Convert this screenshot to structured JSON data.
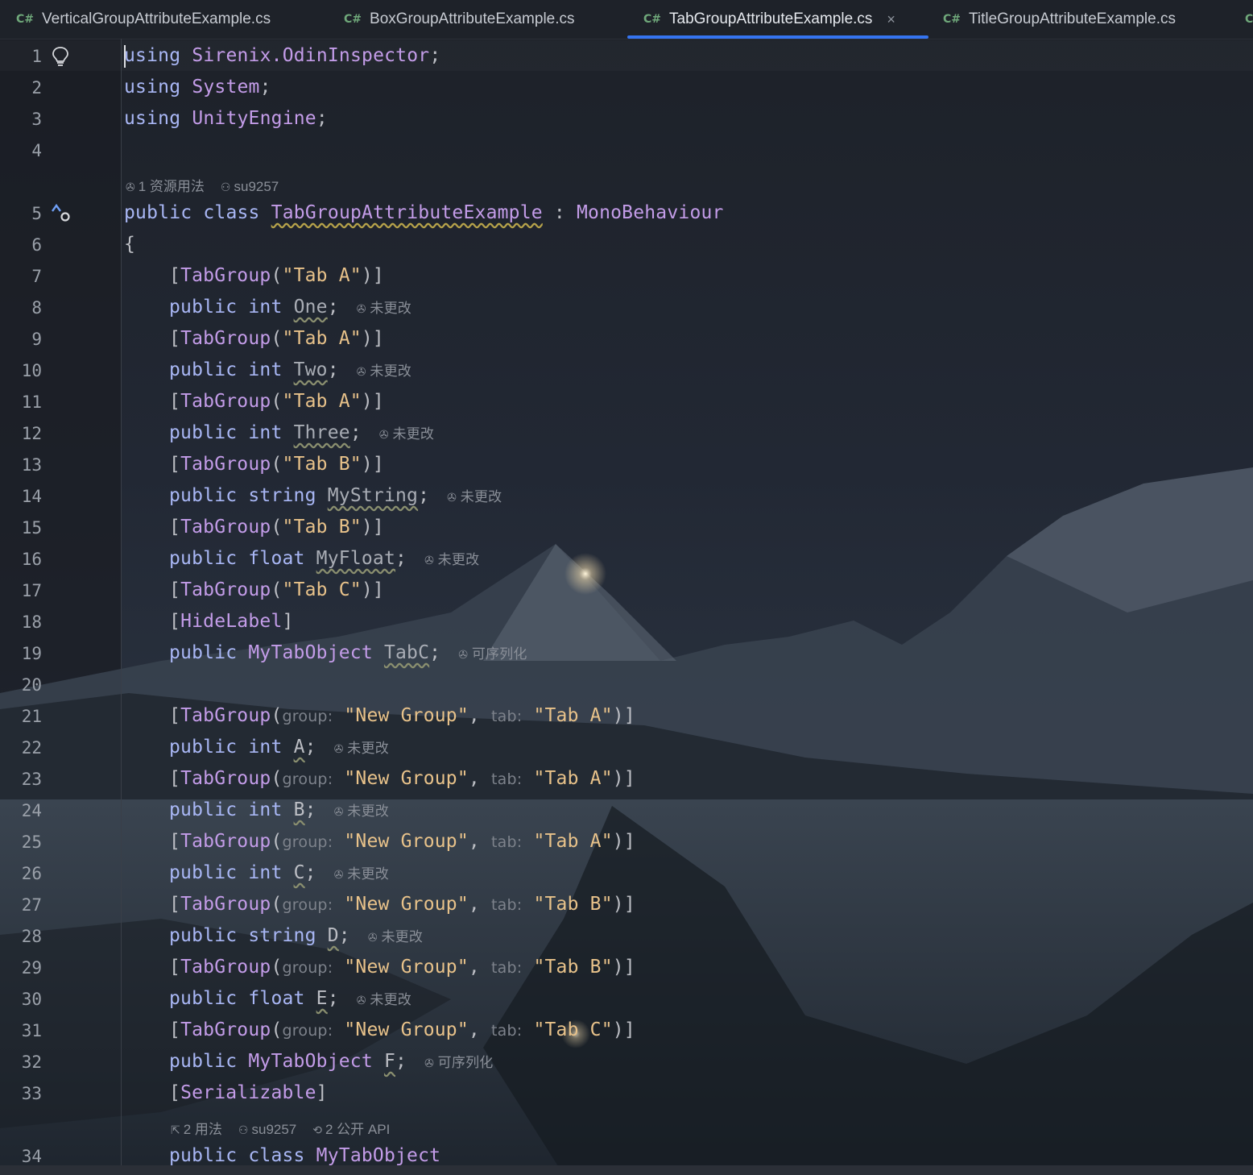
{
  "tabs": [
    {
      "lang": "C#",
      "name": "VerticalGroupAttributeExample.cs"
    },
    {
      "lang": "C#",
      "name": "BoxGroupAttributeExample.cs"
    },
    {
      "lang": "C#",
      "name": "TabGroupAttributeExample.cs",
      "close": "×"
    },
    {
      "lang": "C#",
      "name": "TitleGroupAttributeExample.cs"
    },
    {
      "lang": "C"
    }
  ],
  "line_numbers": [
    "1",
    "2",
    "3",
    "4",
    "5",
    "6",
    "7",
    "8",
    "9",
    "10",
    "11",
    "12",
    "13",
    "14",
    "15",
    "16",
    "17",
    "18",
    "19",
    "20",
    "21",
    "22",
    "23",
    "24",
    "25",
    "26",
    "27",
    "28",
    "29",
    "30",
    "31",
    "32",
    "33",
    "34"
  ],
  "code": {
    "l1": {
      "kw": "using",
      "ns": "Sirenix.OdinInspector",
      "end": ";"
    },
    "l2": {
      "kw": "using",
      "ns": "System",
      "end": ";"
    },
    "l3": {
      "kw": "using",
      "ns": "UnityEngine",
      "end": ";"
    },
    "l5": {
      "kw1": "public",
      "kw2": "class",
      "name": "TabGroupAttributeExample",
      "sep": " : ",
      "base": "MonoBehaviour"
    },
    "l6": "{",
    "l7": {
      "attr": "TabGroup",
      "arg": "\"Tab A\""
    },
    "l8": {
      "type": "int",
      "field": "One",
      "hint": "未更改"
    },
    "l9": {
      "attr": "TabGroup",
      "arg": "\"Tab A\""
    },
    "l10": {
      "type": "int",
      "field": "Two",
      "hint": "未更改"
    },
    "l11": {
      "attr": "TabGroup",
      "arg": "\"Tab A\""
    },
    "l12": {
      "type": "int",
      "field": "Three",
      "hint": "未更改"
    },
    "l13": {
      "attr": "TabGroup",
      "arg": "\"Tab B\""
    },
    "l14": {
      "type": "string",
      "field": "MyString",
      "hint": "未更改"
    },
    "l15": {
      "attr": "TabGroup",
      "arg": "\"Tab B\""
    },
    "l16": {
      "type": "float",
      "field": "MyFloat",
      "hint": "未更改"
    },
    "l17": {
      "attr": "TabGroup",
      "arg": "\"Tab C\""
    },
    "l18": {
      "attr": "HideLabel"
    },
    "l19": {
      "type": "MyTabObject",
      "field": "TabC",
      "hint": "可序列化"
    },
    "l21": {
      "attr": "TabGroup",
      "group_label": "group:",
      "group": "\"New Group\"",
      "tab_label": "tab:",
      "tab": "\"Tab A\""
    },
    "l22": {
      "type": "int",
      "field": "A",
      "hint": "未更改"
    },
    "l23": {
      "attr": "TabGroup",
      "group_label": "group:",
      "group": "\"New Group\"",
      "tab_label": "tab:",
      "tab": "\"Tab A\""
    },
    "l24": {
      "type": "int",
      "field": "B",
      "hint": "未更改"
    },
    "l25": {
      "attr": "TabGroup",
      "group_label": "group:",
      "group": "\"New Group\"",
      "tab_label": "tab:",
      "tab": "\"Tab A\""
    },
    "l26": {
      "type": "int",
      "field": "C",
      "hint": "未更改"
    },
    "l27": {
      "attr": "TabGroup",
      "group_label": "group:",
      "group": "\"New Group\"",
      "tab_label": "tab:",
      "tab": "\"Tab B\""
    },
    "l28": {
      "type": "string",
      "field": "D",
      "hint": "未更改"
    },
    "l29": {
      "attr": "TabGroup",
      "group_label": "group:",
      "group": "\"New Group\"",
      "tab_label": "tab:",
      "tab": "\"Tab B\""
    },
    "l30": {
      "type": "float",
      "field": "E",
      "hint": "未更改"
    },
    "l31": {
      "attr": "TabGroup",
      "group_label": "group:",
      "group": "\"New Group\"",
      "tab_label": "tab:",
      "tab": "\"Tab C\""
    },
    "l32": {
      "type": "MyTabObject",
      "field": "F",
      "hint": "可序列化"
    },
    "l33": {
      "attr": "Serializable"
    },
    "l34": {
      "kw1": "public",
      "kw2": "class",
      "name": "MyTabObject"
    }
  },
  "public_kw": "public",
  "class_meta": {
    "usages": "1 资源用法",
    "author": "su9257"
  },
  "nested_meta": {
    "usages": "2 用法",
    "author": "su9257",
    "api": "2 公开 API"
  },
  "colors": {
    "accent": "#3574f0",
    "keyword": "#a9b7f5",
    "type": "#c39ce8",
    "string": "#e8c28a"
  },
  "icons": [
    "lightbulb-icon",
    "implemented-icon",
    "unity-icon",
    "person-icon",
    "usages-icon",
    "api-icon",
    "close-icon"
  ]
}
